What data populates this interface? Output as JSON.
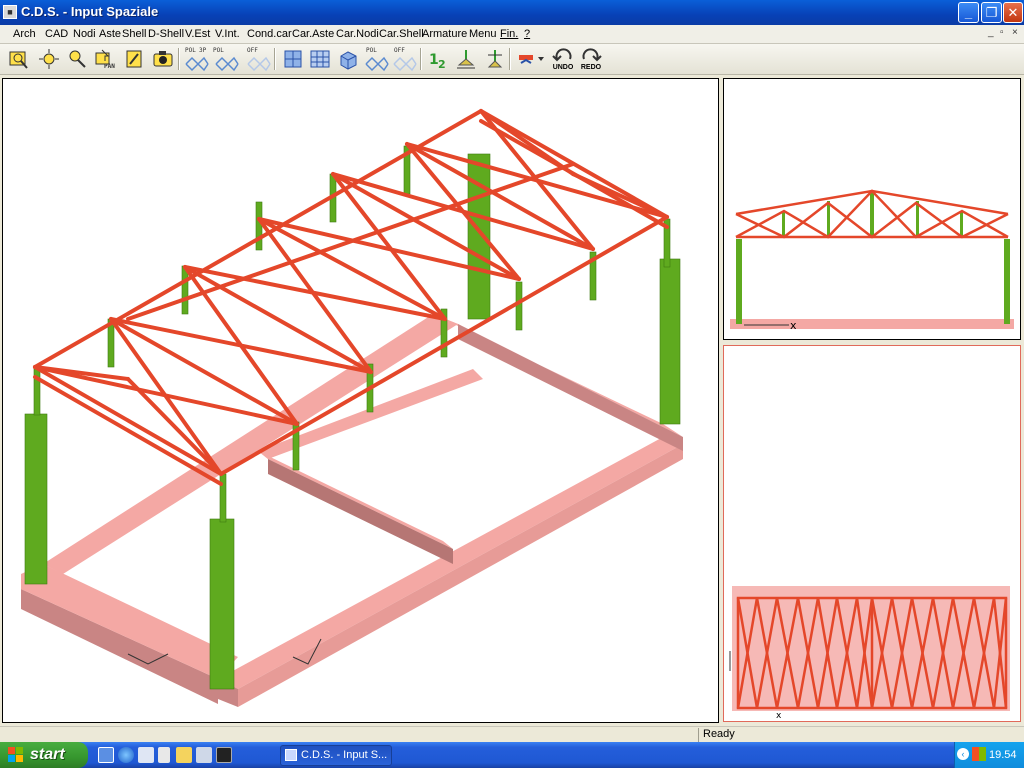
{
  "window": {
    "title": "C.D.S. - Input Spaziale",
    "app_icon": "cds-app-icon"
  },
  "caption_buttons": {
    "minimize": "_",
    "maximize": "❐",
    "close": "✕"
  },
  "menu": {
    "items": [
      "Arch",
      "CAD",
      "Nodi",
      "Aste",
      "Shell",
      "D-Shell",
      "V.Est",
      "V.Int.",
      "Cond.car",
      "Car.Aste",
      "Car.Nodi",
      "Car.Shell",
      "Armature",
      "Menu",
      "Fin.",
      "?"
    ],
    "mdi_controls": [
      "_",
      "▫",
      "×"
    ]
  },
  "toolbar": {
    "labels": {
      "pol1": "POL",
      "threep": "3P",
      "pol2": "POL",
      "off1": "OFF",
      "pol3": "POL",
      "off2": "OFF",
      "pan": "PAN",
      "undo": "UNDO",
      "redo": "REDO"
    }
  },
  "views": {
    "front_axis_label": "x",
    "plan_axis_label": "x"
  },
  "status": {
    "text": "Ready"
  },
  "taskbar": {
    "start_label": "start",
    "task_item": "C.D.S. - Input S...",
    "clock": "19.54"
  },
  "colors": {
    "truss": "#e4472a",
    "column": "#5faa1f",
    "foundation": "#f4a8a4",
    "foundation_dark": "#c98584",
    "titlebar": "#0a5fd8",
    "taskbar": "#245edb"
  }
}
